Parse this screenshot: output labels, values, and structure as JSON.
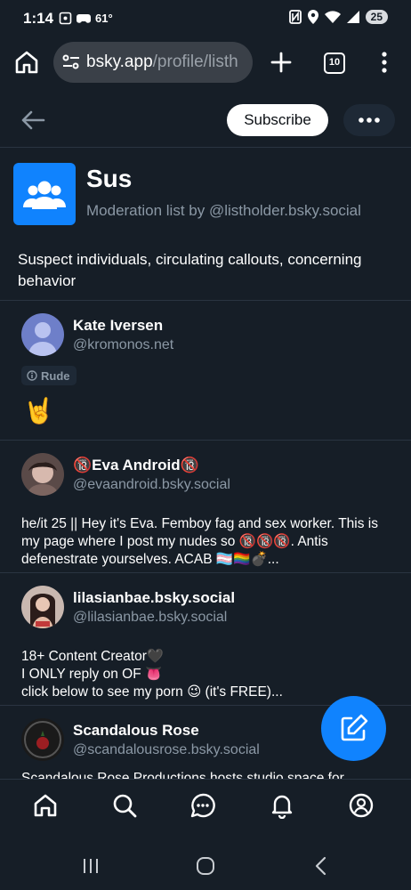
{
  "status_bar": {
    "time": "1:14",
    "temperature": "61°",
    "battery": "25"
  },
  "browser": {
    "url_host": "bsky.app",
    "url_path": "/profile/listh",
    "tab_count": "10"
  },
  "header": {
    "subscribe_label": "Subscribe"
  },
  "list": {
    "title": "Sus",
    "subtitle": "Moderation list by @listholder.bsky.social",
    "description": "Suspect individuals, circulating callouts, concerning behavior",
    "avatar_color": "#1083fe"
  },
  "people": [
    {
      "name": "Kate Iversen",
      "handle": "@kromonos.net",
      "label": "Rude",
      "bio": "🤘"
    },
    {
      "name": "🔞Eva Android🔞",
      "handle": "@evaandroid.bsky.social",
      "bio": "he/it 25 || Hey it's Eva. Femboy fag and sex worker. This is my page where I post my nudes so 🔞🔞🔞. Antis defenestrate yourselves. ACAB 🏳️‍⚧️🏳️‍🌈💣..."
    },
    {
      "name": "lilasianbae.bsky.social",
      "handle": "@lilasianbae.bsky.social",
      "bio": "18+ Content Creator🖤\nI ONLY reply on OF 👅\nclick below to see my porn 😉 (it's FREE)..."
    },
    {
      "name": "Scandalous Rose",
      "handle": "@scandalousrose.bsky.social",
      "bio": "Scandalous Rose Productions hosts studio space for"
    }
  ],
  "colors": {
    "background": "#161e27",
    "accent": "#1083fe",
    "muted_text": "#8b98a5",
    "divider": "#2a3441"
  },
  "icons": {
    "nav": [
      "home-icon",
      "search-icon",
      "chat-icon",
      "bell-icon",
      "profile-icon"
    ],
    "fab": "compose-icon"
  }
}
